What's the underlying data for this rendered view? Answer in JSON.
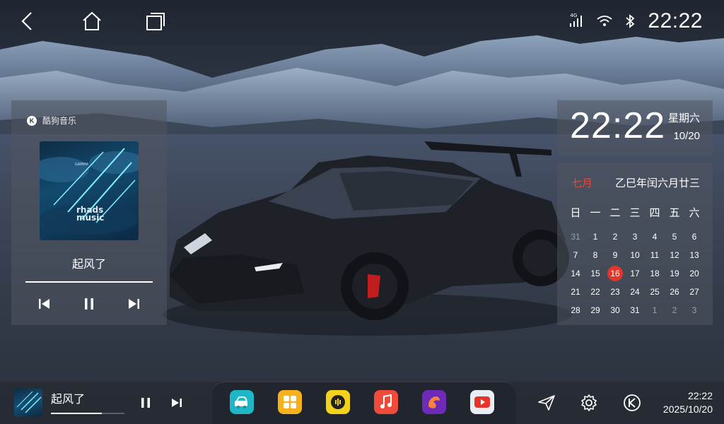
{
  "status_bar": {
    "time": "22:22",
    "signal_label": "4G",
    "icons": [
      "back-icon",
      "home-icon",
      "recents-icon",
      "signal-icon",
      "wifi-icon",
      "bluetooth-icon"
    ]
  },
  "music_widget": {
    "app_name": "酷狗音乐",
    "song_title": "起风了",
    "album_text": "rhads music",
    "album_label": "GAMMA",
    "progress": 1.0
  },
  "clock_widget": {
    "time": "22:22",
    "weekday": "星期六",
    "date": "10/20"
  },
  "calendar_widget": {
    "month": "七月",
    "lunar": "乙巳年闰六月廿三",
    "weekdays": [
      "日",
      "一",
      "二",
      "三",
      "四",
      "五",
      "六"
    ],
    "weeks": [
      [
        "31",
        "1",
        "2",
        "3",
        "4",
        "5",
        "6"
      ],
      [
        "7",
        "8",
        "9",
        "10",
        "11",
        "12",
        "13"
      ],
      [
        "14",
        "15",
        "16",
        "17",
        "18",
        "19",
        "20"
      ],
      [
        "21",
        "22",
        "23",
        "24",
        "25",
        "26",
        "27"
      ],
      [
        "28",
        "29",
        "30",
        "31",
        "1",
        "2",
        "3"
      ]
    ],
    "today": "16",
    "today_color": "#e0362c",
    "accent_color": "#e24b3c"
  },
  "dock": {
    "now_playing_title": "起风了",
    "now_playing_progress": 0.69,
    "apps": [
      {
        "name": "car-service-app-icon",
        "color": "#1fb7c7"
      },
      {
        "name": "app-grid-icon",
        "color": "#f5b21c"
      },
      {
        "name": "kuwo-music-app-icon",
        "color": "#f3d21a"
      },
      {
        "name": "music-app-icon",
        "color": "#f04a3a"
      },
      {
        "name": "browser-app-icon",
        "color": "#6c2bb8"
      },
      {
        "name": "youtube-app-icon",
        "color": "#e9eef4"
      }
    ],
    "right_icons": [
      "navigation-icon",
      "settings-icon",
      "kugou-icon"
    ],
    "time": "22:22",
    "date": "2025/10/20"
  }
}
